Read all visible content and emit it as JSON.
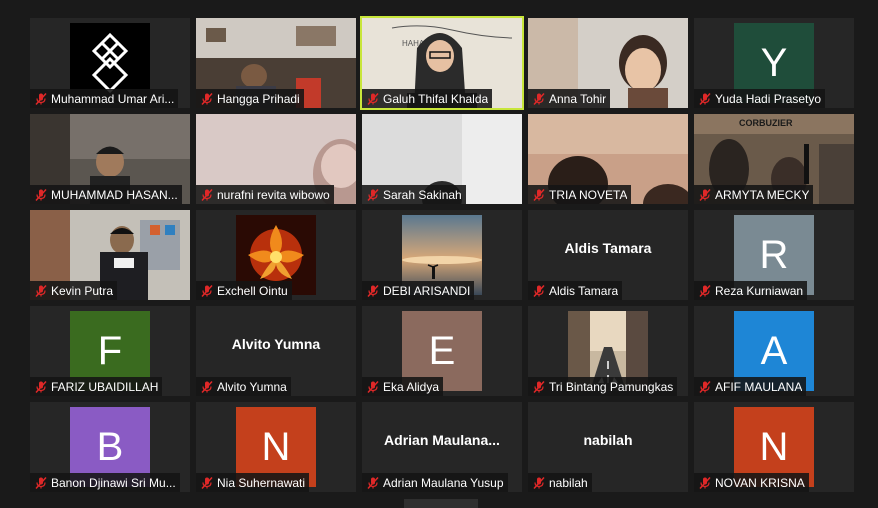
{
  "participants": [
    {
      "name": "Muhammad Umar Ari...",
      "type": "logo"
    },
    {
      "name": "Hangga Prihadi",
      "type": "video"
    },
    {
      "name": "Galuh Thifal Khalda",
      "type": "video",
      "active": true
    },
    {
      "name": "Anna Tohir",
      "type": "video"
    },
    {
      "name": "Yuda Hadi Prasetyo",
      "type": "avatar",
      "letter": "Y",
      "color": "#1f4d3a"
    },
    {
      "name": "MUHAMMAD HASAN...",
      "type": "video"
    },
    {
      "name": "nurafni revita wibowo",
      "type": "video"
    },
    {
      "name": "Sarah Sakinah",
      "type": "video"
    },
    {
      "name": "TRIA NOVETA",
      "type": "video"
    },
    {
      "name": "ARMYTA MECKY",
      "type": "video"
    },
    {
      "name": "Kevin Putra",
      "type": "video"
    },
    {
      "name": "Exchell Ointu",
      "type": "image"
    },
    {
      "name": "DEBI ARISANDI",
      "type": "image"
    },
    {
      "name": "Aldis Tamara",
      "type": "text",
      "display": "Aldis Tamara"
    },
    {
      "name": "Reza Kurniawan",
      "type": "avatar",
      "letter": "R",
      "color": "#7a8a93"
    },
    {
      "name": "FARIZ UBAIDILLAH",
      "type": "avatar",
      "letter": "F",
      "color": "#3a6b1f"
    },
    {
      "name": "Alvito Yumna",
      "type": "text",
      "display": "Alvito Yumna"
    },
    {
      "name": "Eka Alidya",
      "type": "avatar",
      "letter": "E",
      "color": "#8b6a5e"
    },
    {
      "name": "Tri Bintang Pamungkas",
      "type": "image"
    },
    {
      "name": "AFIF MAULANA",
      "type": "avatar",
      "letter": "A",
      "color": "#1e86d6"
    },
    {
      "name": "Banon Djinawi Sri Mu...",
      "type": "avatar",
      "letter": "B",
      "color": "#8a5bc4"
    },
    {
      "name": "Nia Suhernawati",
      "type": "avatar",
      "letter": "N",
      "color": "#c4401c"
    },
    {
      "name": "Adrian Maulana Yusup",
      "type": "text",
      "display": "Adrian  Maulana..."
    },
    {
      "name": "nabilah",
      "type": "text",
      "display": "nabilah"
    },
    {
      "name": "NOVAN KRISNA",
      "type": "avatar",
      "letter": "N",
      "color": "#c4401c"
    }
  ],
  "icons": {
    "muted": "mic-muted-icon"
  },
  "colors": {
    "active_border": "#c8e63a",
    "mute_red": "#e02828",
    "tile_bg": "#262626",
    "page_bg": "#1a1a1a"
  }
}
